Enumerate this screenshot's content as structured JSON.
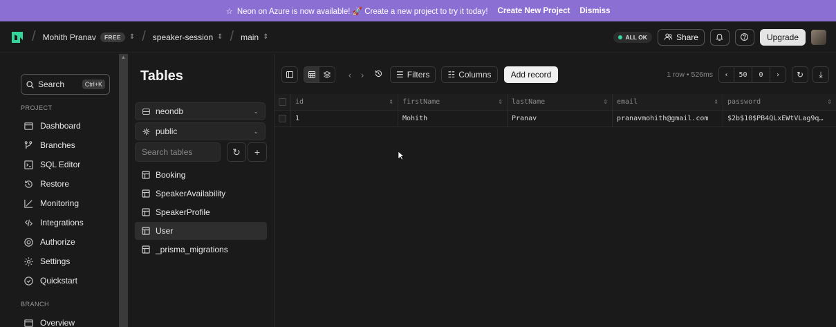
{
  "banner": {
    "icon": "sparkle-icon",
    "message": "Neon on Azure is now available! 🚀 Create a new project to try it today!",
    "cta": "Create New Project",
    "dismiss": "Dismiss"
  },
  "topbar": {
    "org": "Mohith Pranav",
    "plan_badge": "FREE",
    "project": "speaker-session",
    "branch": "main",
    "status": "ALL OK",
    "share": "Share",
    "upgrade": "Upgrade"
  },
  "sidebar": {
    "search_label": "Search",
    "search_shortcut": "Ctrl+K",
    "project_section": "PROJECT",
    "items": [
      {
        "label": "Dashboard",
        "icon": "dashboard-icon"
      },
      {
        "label": "Branches",
        "icon": "branches-icon"
      },
      {
        "label": "SQL Editor",
        "icon": "sql-editor-icon"
      },
      {
        "label": "Restore",
        "icon": "restore-icon"
      },
      {
        "label": "Monitoring",
        "icon": "monitoring-icon"
      },
      {
        "label": "Integrations",
        "icon": "integrations-icon"
      },
      {
        "label": "Authorize",
        "icon": "authorize-icon"
      },
      {
        "label": "Settings",
        "icon": "settings-icon"
      },
      {
        "label": "Quickstart",
        "icon": "quickstart-icon"
      }
    ],
    "branch_section": "BRANCH",
    "branch_items": [
      {
        "label": "Overview",
        "icon": "overview-icon"
      }
    ]
  },
  "tables_panel": {
    "title": "Tables",
    "database": "neondb",
    "schema": "public",
    "search_placeholder": "Search tables",
    "tables": [
      "Booking",
      "SpeakerAvailability",
      "SpeakerProfile",
      "User",
      "_prisma_migrations"
    ],
    "active_table": "User"
  },
  "toolbar": {
    "filters": "Filters",
    "columns": "Columns",
    "add_record": "Add record",
    "row_info": "1 row • 526ms",
    "page_size": "50",
    "offset": "0"
  },
  "grid": {
    "columns": [
      "id",
      "firstName",
      "lastName",
      "email",
      "password"
    ],
    "rows": [
      [
        "1",
        "Mohith",
        "Pranav",
        "pranavmohith@gmail.com",
        "$2b$10$PB4QLxEWtVLag9q…"
      ]
    ]
  }
}
